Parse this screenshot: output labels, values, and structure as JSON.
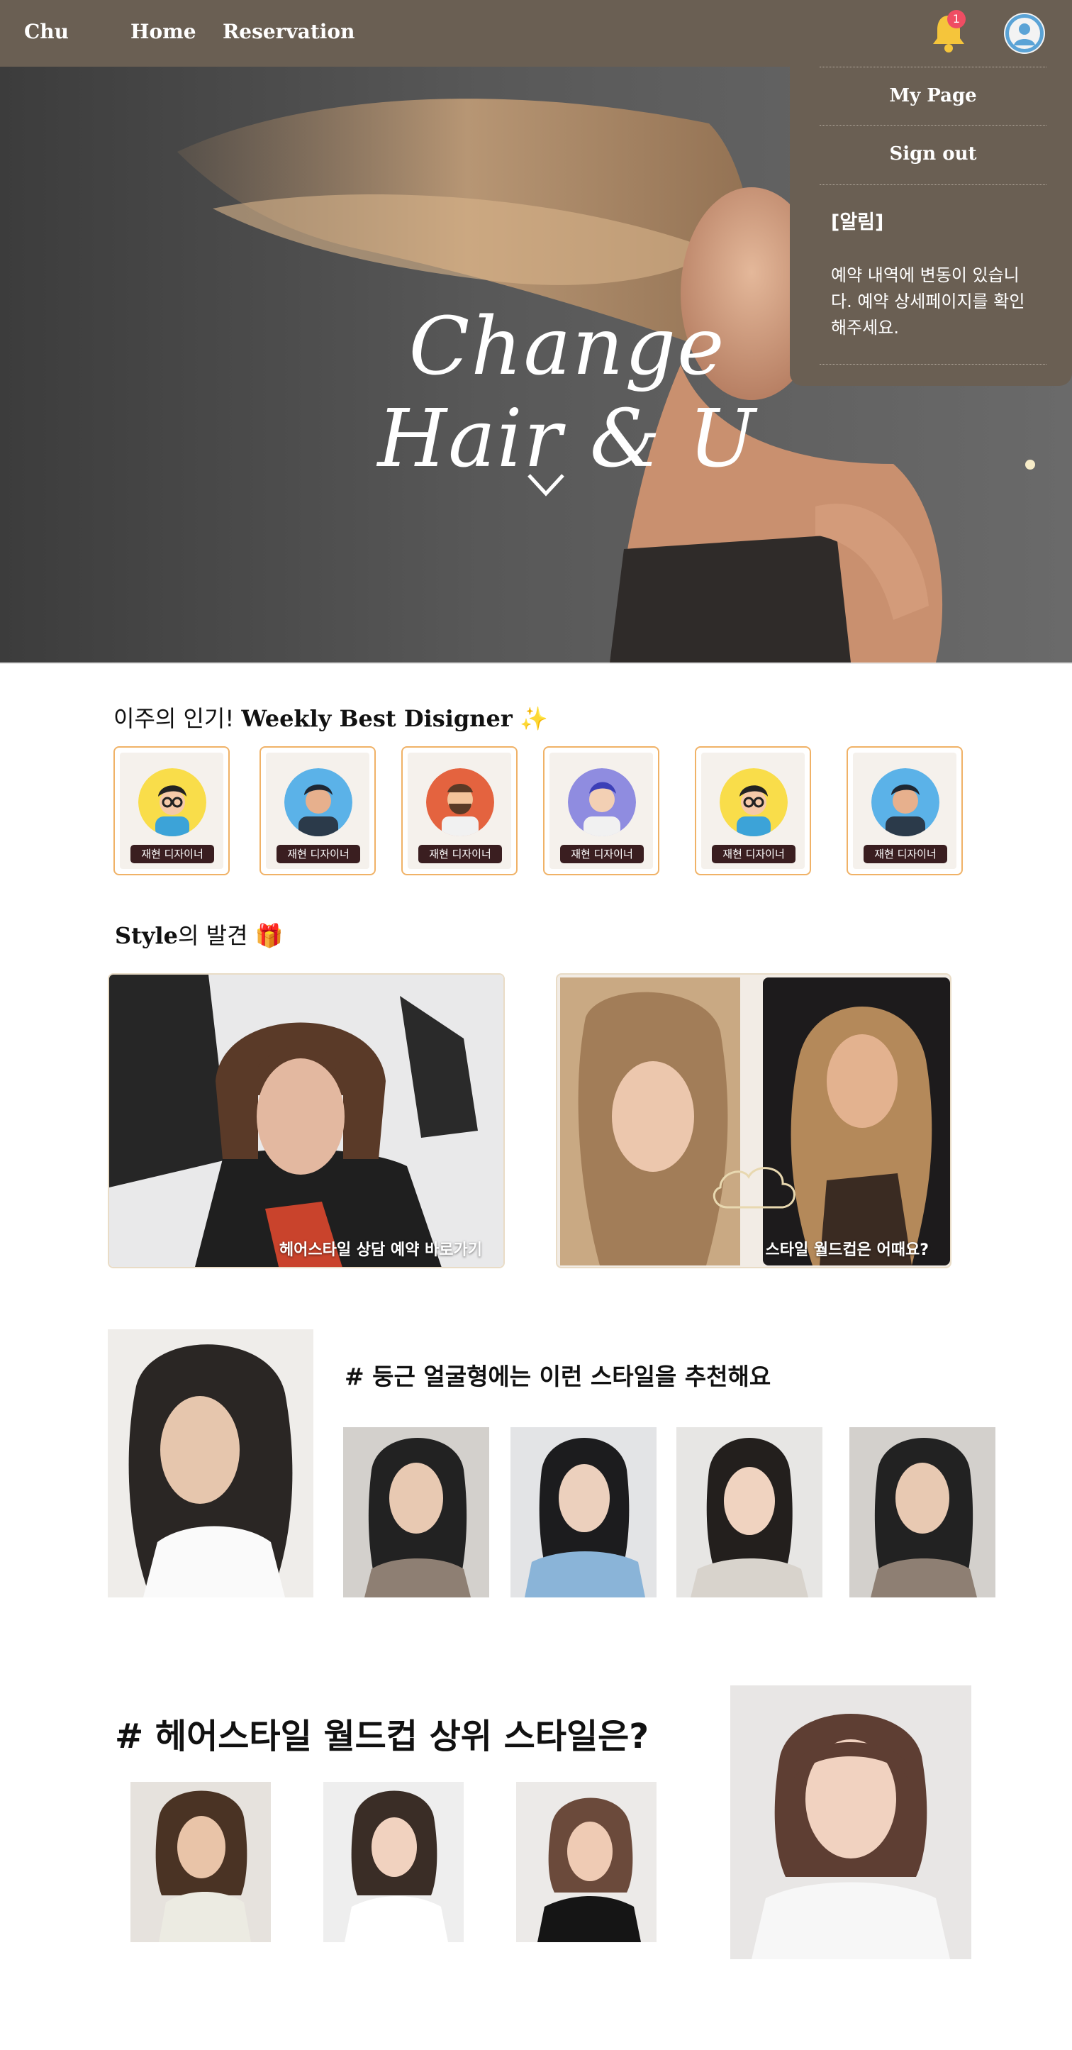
{
  "nav": {
    "brand": "Chu",
    "links": [
      "Home",
      "Reservation"
    ],
    "notification_count": "1"
  },
  "dropdown": {
    "items": [
      "My Page",
      "Sign out"
    ],
    "notice_title": "[알림]",
    "notice_message": "예약 내역에 변동이 있습니다. 예약 상세페이지를 확인해주세요."
  },
  "hero": {
    "title": "Change Hair & U"
  },
  "weekly": {
    "title_prefix": "이주의 인기! ",
    "title_bold": "Weekly Best Disigner",
    "title_icon": "✨",
    "designers": [
      "재현 디자이너",
      "재현 디자이너",
      "재현 디자이너",
      "재현 디자이너",
      "재현 디자이너",
      "재현 디자이너"
    ]
  },
  "style": {
    "title_bold": "Style",
    "title_suffix": "의 발견 ",
    "title_icon": "🎁",
    "promo_left": "헤어스타일 상담 예약 바로가기",
    "promo_right": "스타일 월드컵은 어때요?"
  },
  "round": {
    "title": "# 둥근 얼굴형에는 이런 스타일을 추천해요"
  },
  "worldcup": {
    "title": "# 헤어스타일 월드컵 상위 스타일은?"
  },
  "colors": {
    "nav_bg": "#6a5f53",
    "card_border": "#f0b267",
    "name_tag_bg": "#3a1e20",
    "badge": "#ef4d63",
    "bell": "#f5c53b"
  }
}
